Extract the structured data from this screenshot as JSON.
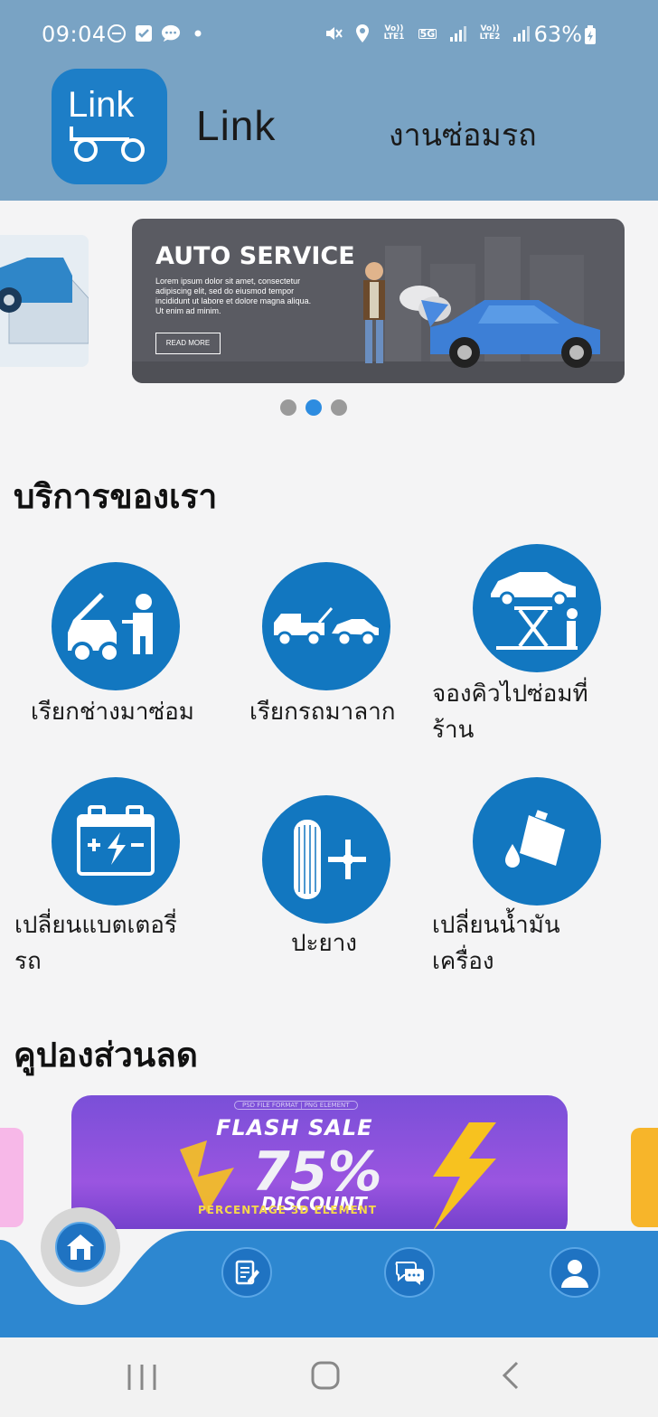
{
  "status_bar": {
    "time": "09:04",
    "battery": "63%",
    "lte1": "Vo)) LTE1",
    "net": "5G",
    "lte2": "Vo)) LTE2"
  },
  "header": {
    "logo_text": "Link",
    "app_name": "Link",
    "subtitle": "งานซ่อมรถ"
  },
  "banner": {
    "title": "AUTO SERVICE",
    "text": "Lorem ipsum dolor sit amet, consectetur adipiscing elit, sed do eiusmod tempor incididunt ut labore et dolore magna aliqua. Ut enim ad minim.",
    "button": "READ MORE",
    "active_dot": 1
  },
  "services": {
    "title": "บริการของเรา",
    "items": [
      {
        "label": "เรียกช่างมาซ่อม",
        "icon": "mechanic-icon"
      },
      {
        "label": "เรียกรถมาลาก",
        "icon": "tow-truck-icon"
      },
      {
        "label_1": "จองคิวไปซ่อมที่",
        "label_2": "ร้าน",
        "icon": "car-lift-icon"
      },
      {
        "label_1": "เปลี่ยนแบตเตอรี่",
        "label_2": "รถ",
        "icon": "battery-icon"
      },
      {
        "label": "ปะยาง",
        "icon": "tire-icon"
      },
      {
        "label_1": "เปลี่ยนน้ำมัน",
        "label_2": "เครื่อง",
        "icon": "oil-can-icon"
      }
    ]
  },
  "coupons": {
    "title": "คูปองส่วนลด",
    "coupon": {
      "flash": "FLASH SALE",
      "percent": "75%",
      "discount": "DISCOUNT",
      "sub": "PERCENTAGE 3D ELEMENT",
      "tag": "PSD FILE FORMAT | PNG ELEMENT"
    }
  },
  "nav": [
    "home-icon",
    "edit-icon",
    "chat-icon",
    "profile-icon"
  ],
  "colors": {
    "header_bg": "#79a3c4",
    "primary": "#1277c0",
    "nav_bg": "#2d87d0"
  }
}
